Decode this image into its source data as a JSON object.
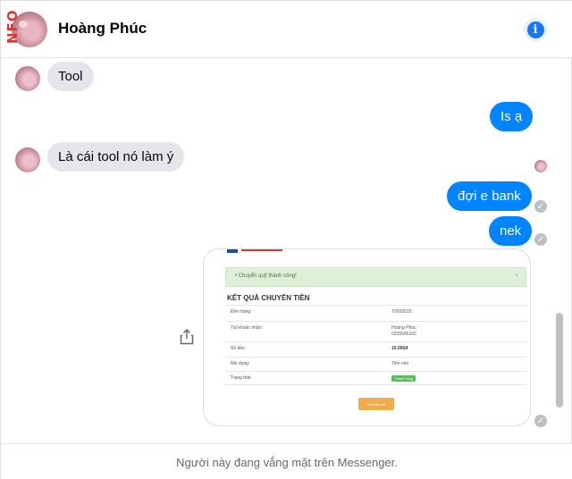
{
  "header": {
    "side_text": "NFO",
    "contact_name": "Hoàng Phúc",
    "info_glyph": "i",
    "info_icon": "info-icon"
  },
  "messages": [
    {
      "from": "contact",
      "text": "Tool"
    },
    {
      "from": "me",
      "text": "Is ạ"
    },
    {
      "from": "contact",
      "text": "Là cái tool nó làm ý"
    },
    {
      "from": "me",
      "text": "đợi e bank"
    },
    {
      "from": "me",
      "text": "nek"
    }
  ],
  "attachment": {
    "alert_text": "• Chuyển quỹ thành công!",
    "alert_close": "×",
    "heading": "KẾT QUẢ CHUYỂN TIỀN",
    "rows": [
      {
        "label": "Đơn hàng:",
        "value": "T0032029"
      },
      {
        "label": "Tài khoản nhận:",
        "value": "Hoàng Phúc",
        "value2": "0325545102"
      },
      {
        "label": "Số tiền:",
        "value": "10.000đ"
      },
      {
        "label": "Nội dung:",
        "value": "Tiền neo"
      },
      {
        "label": "Trạng thái:",
        "value": "Thành công"
      }
    ],
    "button_label": "Xem lịch sử"
  },
  "status": {
    "check_glyph": "✓"
  },
  "footer": {
    "text": "Người này đang vắng mặt trên Messenger."
  },
  "colors": {
    "outgoing_bubble": "#0084ff",
    "incoming_bubble": "#e4e6eb",
    "accent": "#1877f2"
  }
}
